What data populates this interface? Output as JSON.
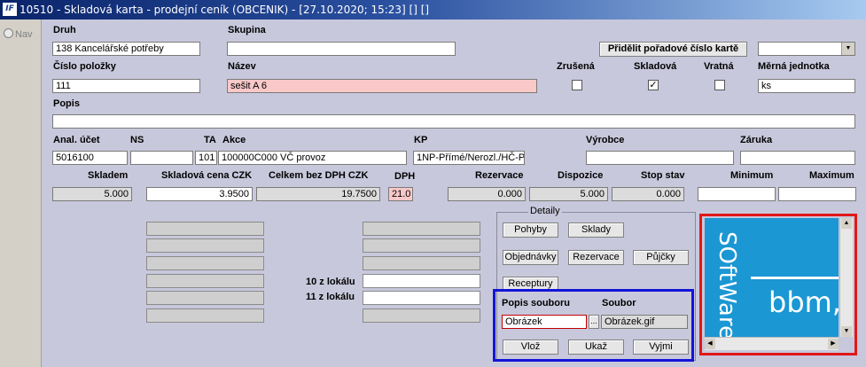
{
  "window": {
    "title": "10510 - Skladová karta - prodejní ceník (OBCENIK) - [27.10.2020; 15:23] [] []",
    "logo": "IF"
  },
  "sidebar": {
    "nav_label": "Nav"
  },
  "labels": {
    "druh": "Druh",
    "skupina": "Skupina",
    "cislo_polozky": "Číslo položky",
    "nazev": "Název",
    "zrusena": "Zrušená",
    "skladova": "Skladová",
    "vratna": "Vratná",
    "merna_jednotka": "Měrná jednotka",
    "popis": "Popis",
    "anal_ucet": "Anal. účet",
    "ns": "NS",
    "ta": "TA",
    "akce": "Akce",
    "kp": "KP",
    "vyrobce": "Výrobce",
    "zaruka": "Záruka",
    "skladem": "Skladem",
    "skladova_cena": "Skladová cena CZK",
    "celkem_bez_dph": "Celkem bez DPH CZK",
    "dph": "DPH",
    "rezervace": "Rezervace",
    "dispozice": "Dispozice",
    "stop_stav": "Stop stav",
    "minimum": "Minimum",
    "maximum": "Maximum",
    "z_lokalu_10": "10 z lokálu",
    "z_lokalu_11": "11 z lokálu",
    "detaily": "Detaily",
    "popis_souboru": "Popis souboru",
    "soubor": "Soubor"
  },
  "fields": {
    "druh": "138 Kancelářské potřeby",
    "skupina": "",
    "cislo_polozky": "111",
    "nazev": "sešit A 6",
    "merna_jednotka": "ks",
    "popis": "",
    "anal_ucet": "5016100",
    "ns": "",
    "ta": "101",
    "akce": "100000C000 VČ provoz",
    "kp": "1NP-Přímé/Nerozl./HČ-Pří",
    "vyrobce": "",
    "zaruka": "",
    "skladem": "5.000",
    "skladova_cena": "3.9500",
    "celkem_bez_dph": "19.7500",
    "dph": "21.0",
    "rezervace": "0.000",
    "dispozice": "5.000",
    "stop_stav": "0.000",
    "minimum": "",
    "maximum": "",
    "z_lokalu_10": "",
    "z_lokalu_11": "",
    "popis_souboru": "Obrázek",
    "soubor": "Obrázek.gif",
    "combo_value": ""
  },
  "checkboxes": {
    "zrusena": false,
    "skladova": true,
    "vratna": false
  },
  "buttons": {
    "pridelit": "Přidělit pořadové číslo kartě",
    "pohyby": "Pohyby",
    "sklady": "Sklady",
    "objednavky": "Objednávky",
    "rezervace": "Rezervace",
    "pujcky": "Půjčky",
    "receptury": "Receptury",
    "vloz": "Vlož",
    "ukaz": "Ukaž",
    "vyjmi": "Vyjmi",
    "browse": "..."
  },
  "image_text": {
    "brand": "SOftWare",
    "company": "bbm,"
  },
  "colors": {
    "highlight_blue": "#1414d8",
    "highlight_red": "#e01818",
    "image_bg": "#1b97d3",
    "form_bg": "#c8c8dc"
  }
}
